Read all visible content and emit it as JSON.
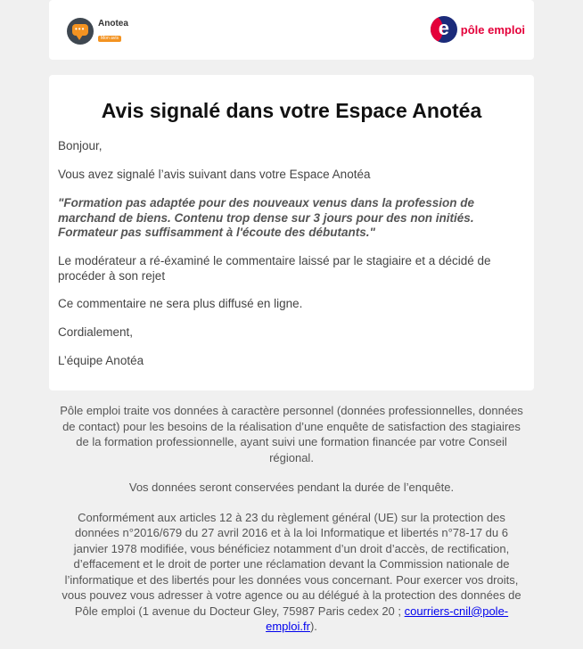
{
  "header": {
    "anotea_name": "Anotea",
    "anotea_tagline": "Mon avis",
    "pole_emploi_brand": "pôle emploi"
  },
  "main": {
    "title": "Avis signalé dans votre Espace Anotéa",
    "greeting": "Bonjour,",
    "intro": "Vous avez signalé l’avis suivant dans votre Espace Anotéa",
    "quote": "\"Formation pas adaptée pour des nouveaux venus dans la profession de marchand de biens. Contenu trop dense sur 3 jours pour des non initiés. Formateur pas suffisamment à l'écoute des débutants.\"",
    "moderation": "Le modérateur a ré-éxaminé le commentaire laissé par le stagiaire et a décidé de procéder à son rejet",
    "notice": "Ce commentaire ne sera plus diffusé en ligne.",
    "closing": "Cordialement,",
    "signature": "L’équipe Anotéa"
  },
  "footer": {
    "paragraph1": "Pôle emploi traite vos données à caractère personnel (données professionnelles, données de contact) pour les besoins de la réalisation d’une enquête de satisfaction des stagiaires de la formation professionnelle, ayant suivi une formation financée par votre Conseil régional.",
    "paragraph2": "Vos données seront conservées pendant la durée de l’enquête.",
    "paragraph3": "Conformément aux articles 12 à 23 du règlement général (UE) sur la protection des données n°2016/679 du 27 avril 2016 et à la loi Informatique et libertés n°78-17 du 6 janvier 1978 modifiée, vous bénéficiez notamment d’un droit d’accès, de rectification, d’effacement et le droit de porter une réclamation devant la Commission nationale de l’informatique et des libertés pour les données vous concernant. Pour exercer vos droits, vous pouvez vous adresser à votre agence ou au délégué à la protection des données de Pôle emploi (1 avenue du Docteur Gley, 75987 Paris cedex 20 ; ",
    "email_link": "courriers-cnil@pole-emploi.fr",
    "paragraph3_end": ")."
  },
  "colors": {
    "anotea_orange": "#f39321",
    "pole_emploi_red": "#e4003a",
    "pole_emploi_blue": "#1b2b7a",
    "link": "#0000ee"
  }
}
